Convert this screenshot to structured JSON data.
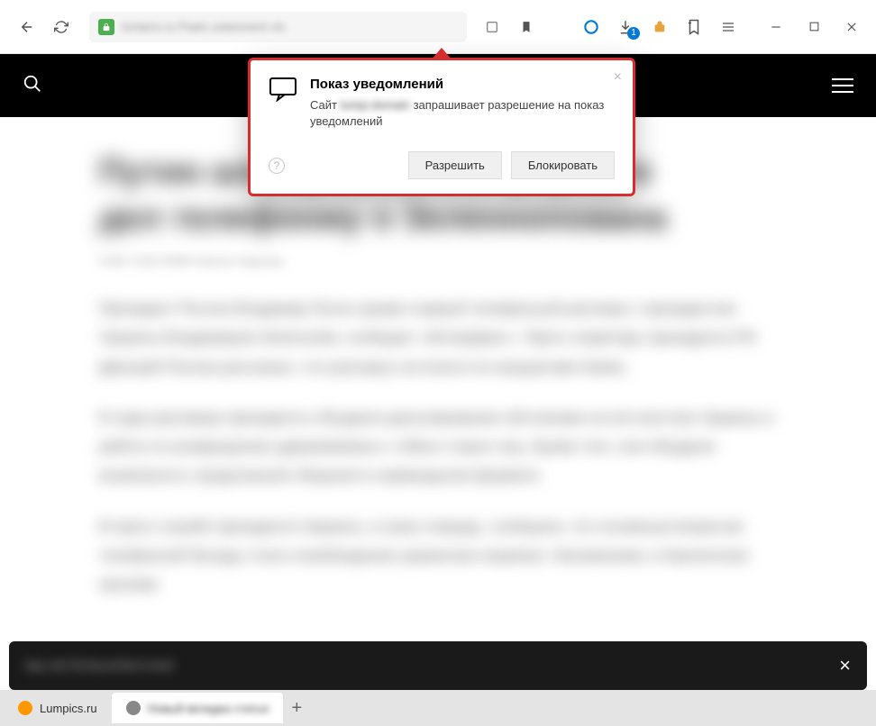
{
  "toolbar": {
    "url_blurred": "lumpics.ru  Popis ustanoveni vis",
    "download_badge": "1"
  },
  "popup": {
    "title": "Показ уведомлений",
    "text_prefix": "Сайт",
    "text_site": "lumpi.domain",
    "text_suffix": "запрашивает разрешение на показ уведомлений",
    "allow": "Разрешить",
    "block": "Блокировать"
  },
  "content": {
    "title1": "Путин альтернативном формате",
    "title2": "дел телефонму о Зеленнопована",
    "meta": "Сейс 5.50170990 Николо Нарские",
    "p1": "Президент России Владимир Путин провел первый телефонный разговор с президентом Украины Владимиром Зеленским, сообщает «Интерфакс». Пресс-секретарь президента РФ Дмитрий Песков рассказал, что разговор состоялся по инициативе Киева.",
    "p2": "В ходе разговора президенты обсудили урегулирование обстановки на юго-востоке Украины и работу по возвращению удерживаемых с обеих сторон лиц. Кроме того, они обсудили возможность продолжения общения в нормандском формате.",
    "p3": "В пресс-службе президента Украины, в свою очередь, сообщили, что основным вопросом телефонной беседы стало освобождение украинских моряков. Напоминаем, в Керченском проливе"
  },
  "banner": {
    "text": "МЫ ИСПОЛЬЗУЕМ КУКИ"
  },
  "tabs": {
    "tab1": "Lumpics.ru",
    "tab2_blurred": "Новый вкладка статья"
  }
}
